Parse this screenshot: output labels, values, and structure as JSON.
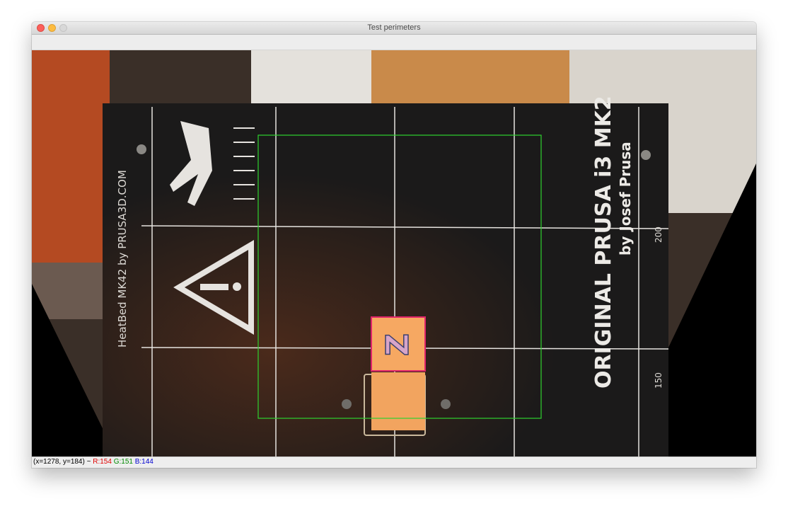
{
  "window": {
    "title": "Test perimeters"
  },
  "bed": {
    "label_left": "HeatBed MK42  by PRUSA3D.COM",
    "brand_line1": "ORIGINAL PRUSA i3 MK2",
    "brand_line2": "by Josef Prusa",
    "scale_200": "200",
    "scale_150": "150",
    "part_letter": "Z"
  },
  "status": {
    "coords": "(x=1278, y=184) ~ ",
    "r": "R:154",
    "g": "G:151",
    "b": "B:144"
  },
  "colors": {
    "detection_box": "#2fd12f",
    "part_box": "#e0246a",
    "part_fill": "#f6a862"
  }
}
